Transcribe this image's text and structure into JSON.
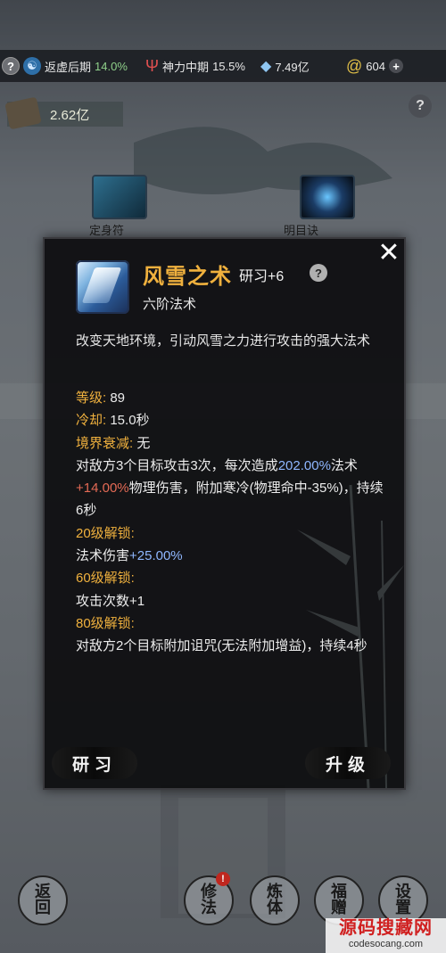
{
  "topbar": {
    "help": "?",
    "realm_icon": "swirl-icon",
    "realm_name": "返虚后期",
    "realm_pct": "14.0%",
    "power_name": "神力中期",
    "power_pct": "15.5%",
    "spirit_stones": "7.49亿",
    "gold": "604",
    "add": "+"
  },
  "background": {
    "money_amount": "2.62亿",
    "help": "?",
    "slot_left_label": "定身符",
    "slot_right_label": "明目诀"
  },
  "dialog": {
    "skill_name": "风雪之术",
    "rank": "研习+6",
    "help": "?",
    "tier": "六阶法术",
    "description": "改变天地环境，引动风雪之力进行攻击的强大法术",
    "level_label": "等级:",
    "level_value": "89",
    "cooldown_label": "冷却:",
    "cooldown_value": "15.0秒",
    "decay_label": "境界衰减:",
    "decay_value": "无",
    "effect_1": "对敌方3个目标攻击3次，每次造成",
    "effect_pct": "202.00%",
    "effect_2": "法术",
    "effect_bonus": "+14.00%",
    "effect_3": "物理伤害，附加寒冷(物理命中-35%)，持续6秒",
    "unlock20_label": "20级解锁:",
    "unlock20_text": "法术伤害",
    "unlock20_value": "+25.00%",
    "unlock60_label": "60级解锁:",
    "unlock60_text": "攻击次数+1",
    "unlock80_label": "80级解锁:",
    "unlock80_text": "对敌方2个目标附加诅咒(无法附加增益)，持续4秒",
    "study_button": "研习",
    "upgrade_button": "升级"
  },
  "bottom_nav": {
    "back_1": "返",
    "back_2": "回",
    "cultivate_1": "修",
    "cultivate_2": "法",
    "body_1": "炼",
    "body_2": "体",
    "gift_1": "福",
    "gift_2": "赠",
    "settings_1": "设",
    "settings_2": "置",
    "badge": "!"
  },
  "watermark": {
    "title": "源码搜藏网",
    "url": "codesocang.com"
  },
  "colors": {
    "accent_gold": "#f0b13e",
    "highlight_blue": "#8fb7ff",
    "realm_green": "#8fd08a"
  }
}
